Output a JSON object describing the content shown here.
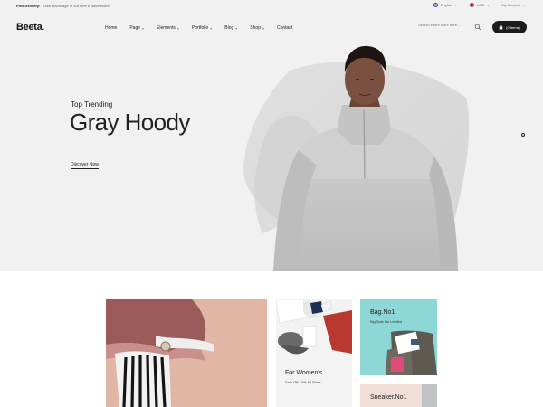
{
  "topbar": {
    "promo_strong": "Free Delivery:",
    "promo_text": "Take advantage of our time to save event",
    "language": "English",
    "currency": "USD",
    "account": "My Account"
  },
  "header": {
    "logo": "Beeta",
    "logo_dot": ".",
    "nav": [
      {
        "label": "Home",
        "dropdown": false
      },
      {
        "label": "Page",
        "dropdown": true
      },
      {
        "label": "Elements",
        "dropdown": true
      },
      {
        "label": "Portfolio",
        "dropdown": true
      },
      {
        "label": "Blog",
        "dropdown": true
      },
      {
        "label": "Shop",
        "dropdown": true
      },
      {
        "label": "Contact",
        "dropdown": false
      }
    ],
    "search_placeholder": "Search entire store here...",
    "cart_label": "(0 Items)"
  },
  "hero": {
    "tagline": "Top Trending",
    "title": "Gray Hoody",
    "cta": "Discover Now",
    "slide_count": 1
  },
  "products": {
    "card2_title": "For Women's",
    "card2_sub": "Sale Off 10% All Store",
    "card3_title": "Bag.No1",
    "card3_sub": "Big Sale No Limited",
    "card4_title": "Sneaker.No1"
  },
  "colors": {
    "accent": "#e04a2f",
    "header_bg": "#f1f1f1",
    "cart_bg": "#1c1c1c",
    "card_bag_bg": "#8dd8d6",
    "card_knit_bg": "#e1b6a5",
    "card_sneaker_bg": "#f1ded6"
  }
}
